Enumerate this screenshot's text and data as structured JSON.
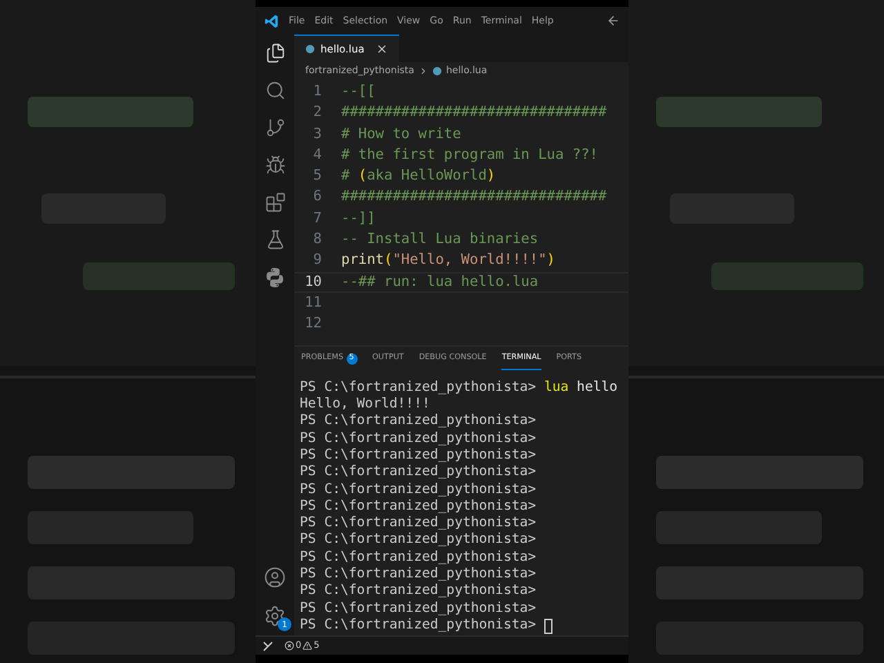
{
  "menu": [
    "File",
    "Edit",
    "Selection",
    "View",
    "Go",
    "Run",
    "Terminal",
    "Help"
  ],
  "tabs": [
    {
      "label": "hello.lua",
      "selected": true
    }
  ],
  "breadcrumb": [
    "fortranized_pythonista",
    "hello.lua"
  ],
  "editor": {
    "lines": [
      {
        "number": "1",
        "current": false,
        "tokens": [
          {
            "text": "--[[",
            "kind": "comment"
          }
        ]
      },
      {
        "number": "2",
        "current": false,
        "tokens": [
          {
            "text": "###############################",
            "kind": "comment"
          }
        ]
      },
      {
        "number": "3",
        "current": false,
        "tokens": [
          {
            "text": "# How to write",
            "kind": "comment"
          }
        ]
      },
      {
        "number": "4",
        "current": false,
        "tokens": [
          {
            "text": "# the first program in Lua ??!",
            "kind": "comment"
          }
        ]
      },
      {
        "number": "5",
        "current": false,
        "tokens": [
          {
            "text": "# ",
            "kind": "comment"
          },
          {
            "text": "(",
            "kind": "paren"
          },
          {
            "text": "aka HelloWorld",
            "kind": "comment"
          },
          {
            "text": ")",
            "kind": "paren"
          }
        ]
      },
      {
        "number": "6",
        "current": false,
        "tokens": [
          {
            "text": "###############################",
            "kind": "comment"
          }
        ]
      },
      {
        "number": "7",
        "current": false,
        "tokens": [
          {
            "text": "--]]",
            "kind": "comment"
          }
        ]
      },
      {
        "number": "8",
        "current": false,
        "tokens": [
          {
            "text": "-- Install Lua binaries",
            "kind": "comment"
          }
        ]
      },
      {
        "number": "9",
        "current": false,
        "tokens": [
          {
            "text": "print",
            "kind": "function"
          },
          {
            "text": "(",
            "kind": "paren"
          },
          {
            "text": "\"Hello, World!!!!\"",
            "kind": "string"
          },
          {
            "text": ")",
            "kind": "paren"
          }
        ]
      },
      {
        "number": "10",
        "current": true,
        "tokens": [
          {
            "text": "--## run: lua hello.lua",
            "kind": "comment"
          }
        ]
      },
      {
        "number": "11",
        "current": false
      },
      {
        "number": "12",
        "current": false
      }
    ]
  },
  "panel_tabs": [
    {
      "label": "PROBLEMS",
      "badge": "5",
      "selected": false
    },
    {
      "label": "OUTPUT",
      "selected": false
    },
    {
      "label": "DEBUG CONSOLE",
      "selected": false
    },
    {
      "label": "TERMINAL",
      "selected": true
    },
    {
      "label": "PORTS",
      "selected": false
    }
  ],
  "terminal": {
    "lines": [
      {
        "tokens": [
          {
            "text": "PS C:\\fortranized_pythonista>",
            "kind": "prompt"
          },
          {
            "text": "lua",
            "kind": "command"
          },
          {
            "text": "hello",
            "kind": "argument"
          }
        ],
        "cursor": false
      },
      {
        "tokens": [
          {
            "text": "Hello, World!!!!",
            "kind": "output"
          }
        ],
        "cursor": false
      },
      {
        "tokens": [
          {
            "text": "PS C:\\fortranized_pythonista>",
            "kind": "prompt"
          }
        ],
        "cursor": false
      },
      {
        "tokens": [
          {
            "text": "PS C:\\fortranized_pythonista>",
            "kind": "prompt"
          }
        ],
        "cursor": false
      },
      {
        "tokens": [
          {
            "text": "PS C:\\fortranized_pythonista>",
            "kind": "prompt"
          }
        ],
        "cursor": false
      },
      {
        "tokens": [
          {
            "text": "PS C:\\fortranized_pythonista>",
            "kind": "prompt"
          }
        ],
        "cursor": false
      },
      {
        "tokens": [
          {
            "text": "PS C:\\fortranized_pythonista>",
            "kind": "prompt"
          }
        ],
        "cursor": false
      },
      {
        "tokens": [
          {
            "text": "PS C:\\fortranized_pythonista>",
            "kind": "prompt"
          }
        ],
        "cursor": false
      },
      {
        "tokens": [
          {
            "text": "PS C:\\fortranized_pythonista>",
            "kind": "prompt"
          }
        ],
        "cursor": false
      },
      {
        "tokens": [
          {
            "text": "PS C:\\fortranized_pythonista>",
            "kind": "prompt"
          }
        ],
        "cursor": false
      },
      {
        "tokens": [
          {
            "text": "PS C:\\fortranized_pythonista>",
            "kind": "prompt"
          }
        ],
        "cursor": false
      },
      {
        "tokens": [
          {
            "text": "PS C:\\fortranized_pythonista>",
            "kind": "prompt"
          }
        ],
        "cursor": false
      },
      {
        "tokens": [
          {
            "text": "PS C:\\fortranized_pythonista>",
            "kind": "prompt"
          }
        ],
        "cursor": false
      },
      {
        "tokens": [
          {
            "text": "PS C:\\fortranized_pythonista>",
            "kind": "prompt"
          }
        ],
        "cursor": false
      },
      {
        "tokens": [
          {
            "text": "PS C:\\fortranized_pythonista>",
            "kind": "prompt"
          }
        ],
        "cursor": true
      }
    ]
  },
  "settings_badge": "1",
  "status_bar": {
    "errors": "0",
    "warnings": "5"
  }
}
